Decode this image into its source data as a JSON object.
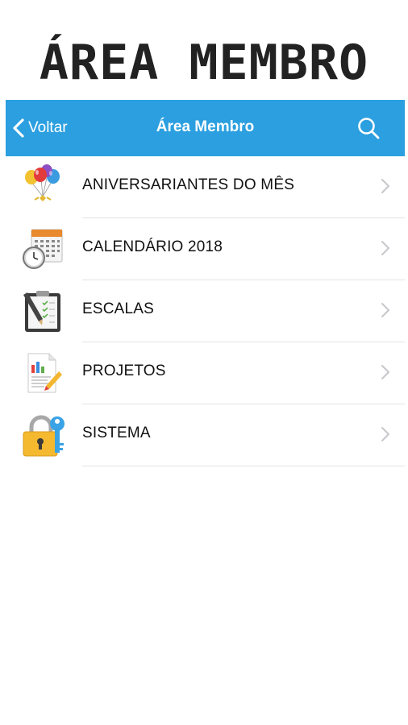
{
  "header": {
    "title": "ÁREA MEMBRO"
  },
  "navbar": {
    "back_label": "Voltar",
    "title": "Área Membro",
    "color": "#2b9fe0",
    "search_icon": "search-icon"
  },
  "menu": {
    "items": [
      {
        "label": "ANIVERSARIANTES DO MÊS",
        "icon": "balloons-icon"
      },
      {
        "label": "CALENDÁRIO 2018",
        "icon": "calendar-clock-icon"
      },
      {
        "label": "ESCALAS",
        "icon": "clipboard-checklist-icon"
      },
      {
        "label": "PROJETOS",
        "icon": "report-chart-icon"
      },
      {
        "label": "SISTEMA",
        "icon": "padlock-key-icon"
      }
    ]
  }
}
